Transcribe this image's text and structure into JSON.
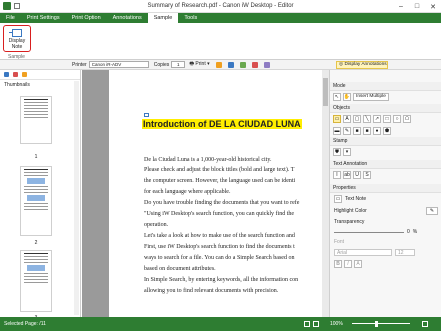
{
  "window": {
    "title": "Summary of Research.pdf - Canon iW Desktop - Editor",
    "minimize": "–",
    "maximize": "□",
    "close": "✕"
  },
  "tabs": [
    "File",
    "Print Settings",
    "Print Option",
    "Annotations",
    "Sample",
    "Tools"
  ],
  "active_tab": "Sample",
  "ribbon": {
    "display_note_label": "Display\nNote",
    "group_label": "Sample"
  },
  "toolbar": {
    "printer_label": "Printer",
    "printer_value": "Canon iR-ADV",
    "copies_label": "Copies",
    "copies_value": "1",
    "print_label": "Print",
    "display_annotations_label": "Display Annotations"
  },
  "thumbnails": {
    "heading": "Thumbnails",
    "pages": [
      "1",
      "2",
      "3"
    ]
  },
  "document": {
    "heading": "Introduction of DE LA CIUDAD LUNA",
    "lines": [
      "De la Ciudad Luna is a 1,000-year-old historical city.",
      "Please check and adjust the block titles (bold and large text). T",
      "the computer screen. However, the language used can be identi",
      "for each language where applicable.",
      "Do you have trouble finding the documents that you want to refe",
      "\"Using iW Desktop's search function, you can quickly find the",
      "operation.",
      "Let's take a look at how to make use of the search function and",
      "First, use iW Desktop's search function to find the documents t",
      "ways to search for a file. You can do a Simple Search based on",
      "based on document attributes.",
      "In Simple Search, by entering keywords, all the information con",
      "allowing you to find relevant documents with precision."
    ]
  },
  "right_panel": {
    "mode_header": "Mode",
    "insert_multiple": "Insert Multiple",
    "objects_header": "Objects",
    "stamp_header": "Stamp",
    "text_annotation_header": "Text Annotation",
    "properties_header": "Properties",
    "properties_object": "Text Note",
    "highlight_color_label": "Highlight Color",
    "transparency_label": "Transparency",
    "transparency_value": "0",
    "transparency_unit": "%",
    "font_label": "Font",
    "font_value": "Arial",
    "font_size": "12"
  },
  "status": {
    "selected_page": "Selected Page: /11",
    "zoom": "100%"
  },
  "colors": {
    "brand_green": "#2e7d32",
    "highlight_yellow": "#ffee00",
    "callout_red": "#d81f1f"
  }
}
